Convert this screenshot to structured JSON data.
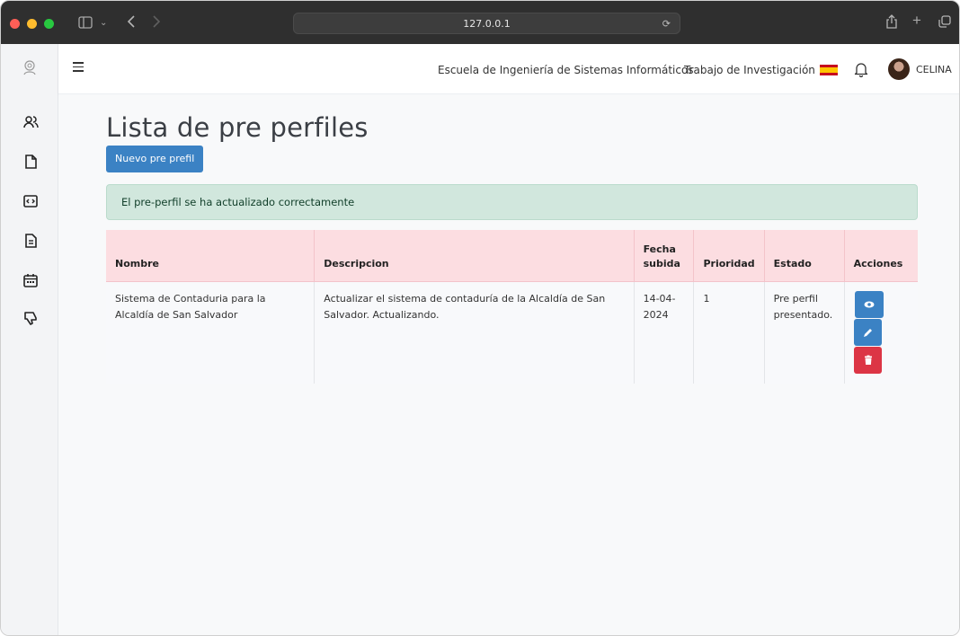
{
  "browser": {
    "url": "127.0.0.1"
  },
  "topnav": {
    "school": "Escuela de Ingeniería de Sistemas Informáticos",
    "project": "Trabajo de Investigación",
    "user": "CELINA"
  },
  "sidebar": {
    "items": [
      "users-icon",
      "file-icon",
      "code-window-icon",
      "document-icon",
      "calendar-icon",
      "thumbs-down-icon"
    ]
  },
  "page": {
    "title": "Lista de pre perfiles",
    "new_button": "Nuevo pre prefil",
    "alert": "El pre-perfil se ha actualizado correctamente"
  },
  "table": {
    "headers": {
      "nombre": "Nombre",
      "descripcion": "Descripcion",
      "fecha_line1": "Fecha",
      "fecha_line2": "subida",
      "prioridad": "Prioridad",
      "estado": "Estado",
      "acciones": "Acciones"
    },
    "rows": [
      {
        "nombre": "Sistema de Contaduria para la Alcaldía de San Salvador",
        "descripcion": "Actualizar el sistema de contaduría de la Alcaldía de San Salvador. Actualizando.",
        "fecha_line1": "14-04-",
        "fecha_line2": "2024",
        "prioridad": "1",
        "estado": "Pre perfil presentado."
      }
    ]
  },
  "colors": {
    "primary": "#3b82c4",
    "danger": "#dc3545",
    "alert_bg": "#d1e7dd",
    "table_header_bg": "#fcdde1"
  }
}
